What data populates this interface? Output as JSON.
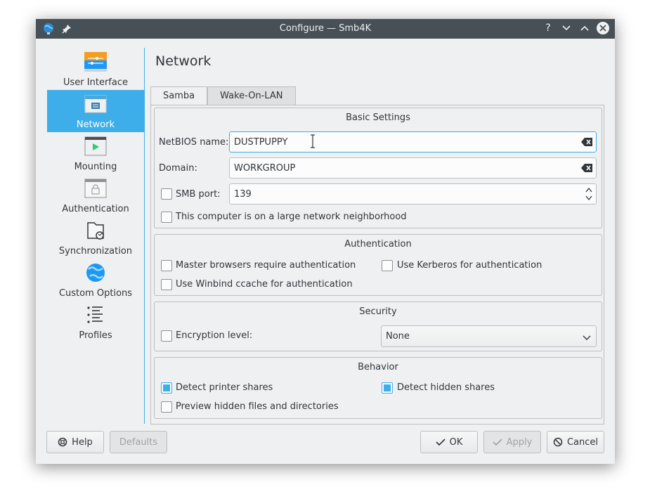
{
  "window": {
    "title": "Configure — Smb4K"
  },
  "titlebar": {
    "help": "?",
    "minimize": "⌄",
    "maximize": "⌃"
  },
  "sidebar": {
    "items": [
      {
        "label": "User Interface",
        "icon": "user-interface-icon"
      },
      {
        "label": "Network",
        "icon": "network-icon",
        "active": true
      },
      {
        "label": "Mounting",
        "icon": "mounting-icon"
      },
      {
        "label": "Authentication",
        "icon": "authentication-icon"
      },
      {
        "label": "Synchronization",
        "icon": "synchronization-icon"
      },
      {
        "label": "Custom Options",
        "icon": "custom-options-icon"
      },
      {
        "label": "Profiles",
        "icon": "profiles-icon"
      }
    ]
  },
  "page": {
    "title": "Network"
  },
  "tabs": [
    {
      "label": "Samba",
      "active": true
    },
    {
      "label": "Wake-On-LAN"
    }
  ],
  "basic": {
    "title": "Basic Settings",
    "netbios_label": "NetBIOS name:",
    "netbios_value": "DUSTPUPPY",
    "domain_label": "Domain:",
    "domain_value": "WORKGROUP",
    "smbport_label": "SMB port:",
    "smbport_value": "139",
    "smbport_checked": false,
    "large_network_label": "This computer is on a large network neighborhood",
    "large_network_checked": false
  },
  "authentication": {
    "title": "Authentication",
    "master_browsers_label": "Master browsers require authentication",
    "kerberos_label": "Use Kerberos for authentication",
    "winbind_label": "Use Winbind ccache for authentication"
  },
  "security": {
    "title": "Security",
    "encryption_label": "Encryption level:",
    "encryption_value": "None"
  },
  "behavior": {
    "title": "Behavior",
    "printer_label": "Detect printer shares",
    "printer_checked": true,
    "hidden_label": "Detect hidden shares",
    "hidden_checked": true,
    "preview_label": "Preview hidden files and directories",
    "preview_checked": false
  },
  "buttons": {
    "help": "Help",
    "defaults": "Defaults",
    "ok": "OK",
    "apply": "Apply",
    "cancel": "Cancel"
  },
  "colors": {
    "accent": "#3daee9",
    "titlebar": "#475057",
    "window_bg": "#eff0f1"
  }
}
